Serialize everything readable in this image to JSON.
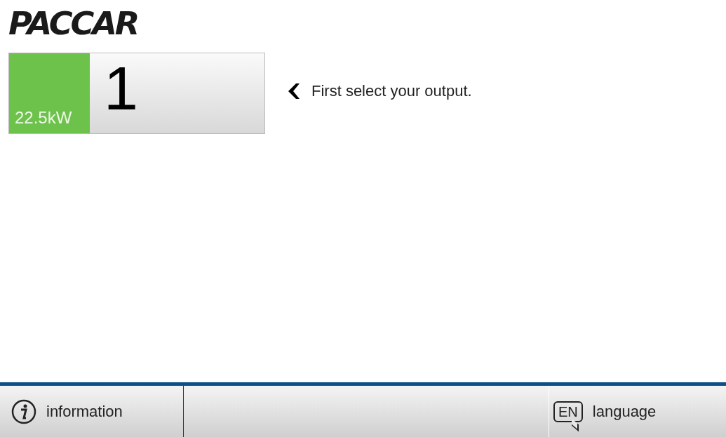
{
  "logo": {
    "text": "PACCAR"
  },
  "outputs": [
    {
      "power": "22.5kW",
      "number": "1",
      "selected": true
    }
  ],
  "hint": {
    "text": "First select your output."
  },
  "footer": {
    "buttons": [
      {
        "kind": "info",
        "label": "information"
      },
      {
        "kind": "language",
        "code": "EN",
        "label": "language"
      }
    ]
  }
}
